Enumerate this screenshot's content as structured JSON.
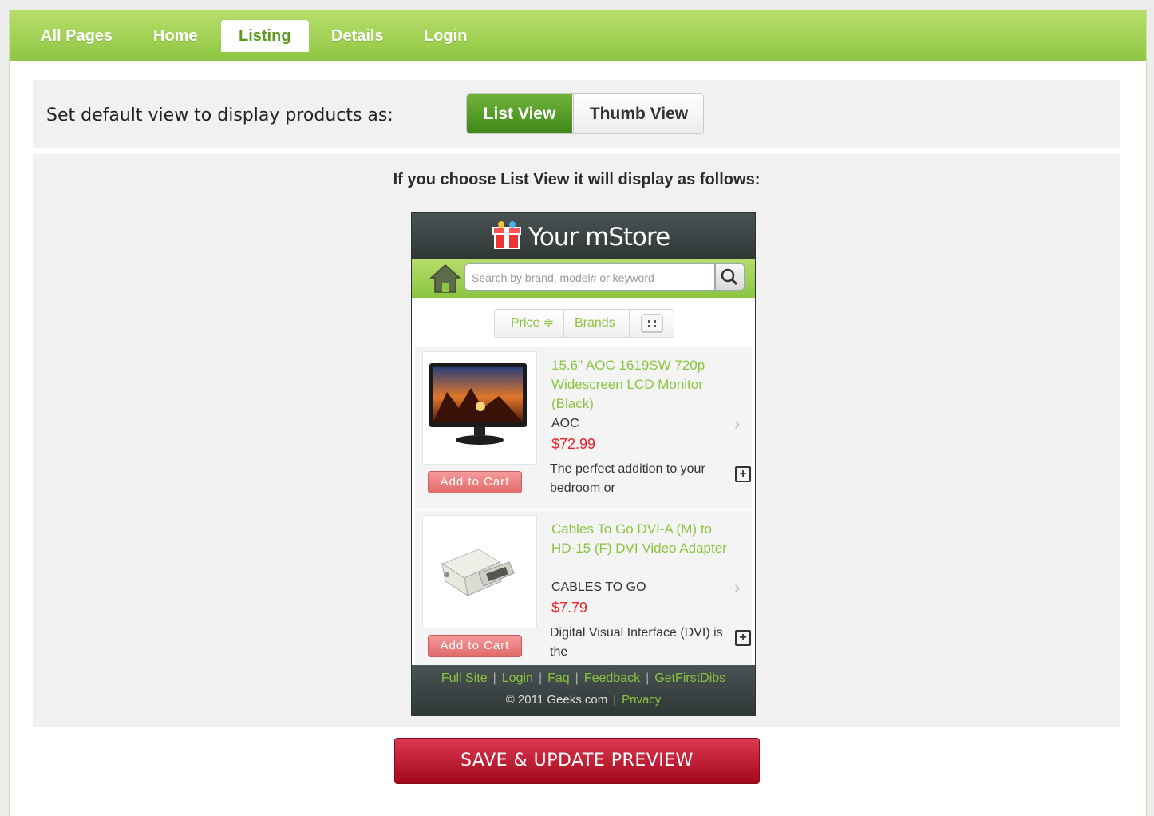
{
  "nav": {
    "items": [
      {
        "label": "All Pages"
      },
      {
        "label": "Home"
      },
      {
        "label": "Listing"
      },
      {
        "label": "Details"
      },
      {
        "label": "Login"
      }
    ],
    "active": "Listing"
  },
  "view_setting": {
    "label": "Set default view to display products as:",
    "options": [
      {
        "label": "List View"
      },
      {
        "label": "Thumb View"
      }
    ],
    "selected": "List View"
  },
  "preview": {
    "caption": "If you choose List View it will display as follows:",
    "store_name": "Your mStore",
    "search_placeholder": "Search by brand, model# or keyword",
    "filters": [
      {
        "label": "Price ≑"
      },
      {
        "label": "Brands"
      }
    ],
    "products": [
      {
        "title": "15.6\" AOC 1619SW 720p Widescreen LCD Monitor (Black)",
        "brand": "AOC",
        "price": "$72.99",
        "description": "The perfect addition to your bedroom or",
        "cart_label": "Add to Cart"
      },
      {
        "title": "Cables To Go DVI-A (M) to HD-15 (F) DVI Video Adapter",
        "brand": "CABLES TO GO",
        "price": "$7.79",
        "description": "Digital Visual Interface (DVI) is the",
        "cart_label": "Add to Cart"
      }
    ],
    "footer_links": [
      {
        "label": "Full Site"
      },
      {
        "label": "Login"
      },
      {
        "label": "Faq"
      },
      {
        "label": "Feedback"
      },
      {
        "label": "GetFirstDibs"
      }
    ],
    "copyright": "© 2011 Geeks.com",
    "privacy": "Privacy"
  },
  "save_button": {
    "label": "SAVE & UPDATE PREVIEW"
  },
  "colors": {
    "nav_green": "#8fc642",
    "accent_green": "#8ac43f",
    "price_red": "#e8202a",
    "save_red": "#b8102a"
  }
}
